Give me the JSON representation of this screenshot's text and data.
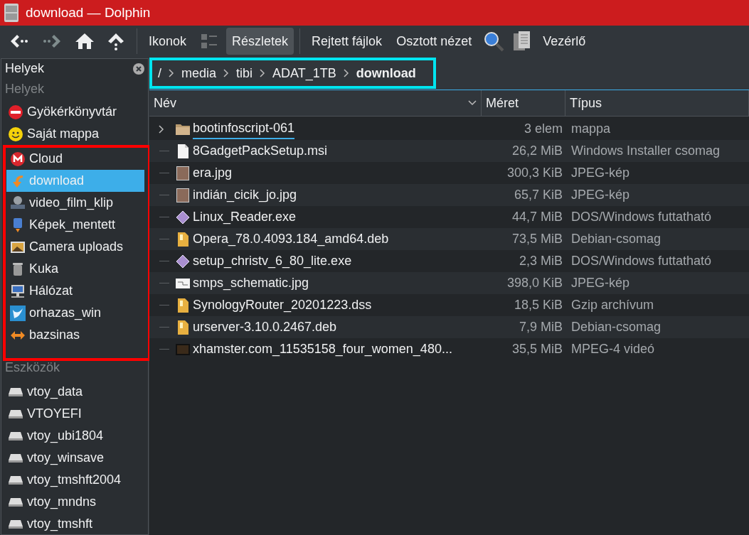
{
  "window": {
    "title": "download — Dolphin"
  },
  "toolbar": {
    "buttons": [
      {
        "kind": "back",
        "disabled": false
      },
      {
        "kind": "forward",
        "disabled": true
      },
      {
        "kind": "home",
        "disabled": false
      },
      {
        "kind": "up",
        "disabled": false
      }
    ],
    "views": [
      {
        "kind": "text",
        "label": "Ikonok",
        "selected": false
      },
      {
        "kind": "compact",
        "selected": false
      },
      {
        "kind": "text",
        "label": "Részletek",
        "selected": true
      }
    ],
    "actions": [
      {
        "kind": "text",
        "label": "Rejtett fájlok"
      },
      {
        "kind": "text",
        "label": "Osztott nézet"
      },
      {
        "kind": "search"
      },
      {
        "kind": "preview"
      },
      {
        "kind": "text",
        "label": "Vezérlő"
      }
    ]
  },
  "sidebar": {
    "title": "Helyek",
    "sections": [
      {
        "heading": "Helyek",
        "items": [
          {
            "label": "Gyökérkönyvtár",
            "kind": "root",
            "selected": false,
            "highlighted": false
          },
          {
            "label": "Saját mappa",
            "kind": "smiley",
            "selected": false,
            "highlighted": false
          },
          {
            "label": "Cloud",
            "kind": "cloud",
            "selected": false,
            "highlighted": true
          },
          {
            "label": "download",
            "kind": "download",
            "selected": true,
            "highlighted": true
          },
          {
            "label": "video_film_klip",
            "kind": "film",
            "selected": false,
            "highlighted": true
          },
          {
            "label": "Képek_mentett",
            "kind": "bookmark",
            "selected": false,
            "highlighted": true
          },
          {
            "label": "Camera uploads",
            "kind": "picture",
            "selected": false,
            "highlighted": true
          },
          {
            "label": "Kuka",
            "kind": "trash",
            "selected": false,
            "highlighted": true
          },
          {
            "label": "Hálózat",
            "kind": "network",
            "selected": false,
            "highlighted": true
          },
          {
            "label": "orhazas_win",
            "kind": "bird",
            "selected": false,
            "highlighted": true
          },
          {
            "label": "bazsinas",
            "kind": "arrows",
            "selected": false,
            "highlighted": true
          }
        ]
      },
      {
        "heading": "Eszközök",
        "items": [
          {
            "label": "vtoy_data",
            "kind": "drive",
            "selected": false,
            "highlighted": false
          },
          {
            "label": "VTOYEFI",
            "kind": "drive",
            "selected": false,
            "highlighted": false
          },
          {
            "label": "vtoy_ubi1804",
            "kind": "drive",
            "selected": false,
            "highlighted": false
          },
          {
            "label": "vtoy_winsave",
            "kind": "drive",
            "selected": false,
            "highlighted": false
          },
          {
            "label": "vtoy_tmshft2004",
            "kind": "drive",
            "selected": false,
            "highlighted": false
          },
          {
            "label": "vtoy_mndns",
            "kind": "drive",
            "selected": false,
            "highlighted": false
          },
          {
            "label": "vtoy_tmshft",
            "kind": "drive",
            "selected": false,
            "highlighted": false
          }
        ]
      }
    ]
  },
  "breadcrumb": {
    "highlighted": true,
    "segments": [
      {
        "label": "/",
        "current": false
      },
      {
        "label": "media",
        "current": false
      },
      {
        "label": "tibi",
        "current": false
      },
      {
        "label": "ADAT_1TB",
        "current": false
      },
      {
        "label": "download",
        "current": true
      }
    ]
  },
  "table": {
    "columns": [
      "Név",
      "Méret",
      "Típus"
    ],
    "rows": [
      {
        "name": "bootinfoscript-061",
        "size": "3 elem",
        "type": "mappa",
        "kind": "folder",
        "expandable": true,
        "hovered": true
      },
      {
        "name": "8GadgetPackSetup.msi",
        "size": "26,2 MiB",
        "type": "Windows Installer csomag",
        "kind": "document",
        "expandable": false,
        "hovered": false
      },
      {
        "name": "era.jpg",
        "size": "300,3 KiB",
        "type": "JPEG-kép",
        "kind": "image",
        "expandable": false,
        "hovered": false
      },
      {
        "name": "indián_cicik_jo.jpg",
        "size": "65,7 KiB",
        "type": "JPEG-kép",
        "kind": "image",
        "expandable": false,
        "hovered": false
      },
      {
        "name": "Linux_Reader.exe",
        "size": "44,7 MiB",
        "type": "DOS/Windows futtatható",
        "kind": "exe",
        "expandable": false,
        "hovered": false
      },
      {
        "name": "Opera_78.0.4093.184_amd64.deb",
        "size": "73,5 MiB",
        "type": "Debian-csomag",
        "kind": "package",
        "expandable": false,
        "hovered": false
      },
      {
        "name": "setup_christv_6_80_lite.exe",
        "size": "2,3 MiB",
        "type": "DOS/Windows futtatható",
        "kind": "exe",
        "expandable": false,
        "hovered": false
      },
      {
        "name": "smps_schematic.jpg",
        "size": "398,0 KiB",
        "type": "JPEG-kép",
        "kind": "schematic",
        "expandable": false,
        "hovered": false
      },
      {
        "name": "SynologyRouter_20201223.dss",
        "size": "18,5 KiB",
        "type": "Gzip archívum",
        "kind": "package",
        "expandable": false,
        "hovered": false
      },
      {
        "name": "urserver-3.10.0.2467.deb",
        "size": "7,9 MiB",
        "type": "Debian-csomag",
        "kind": "package",
        "expandable": false,
        "hovered": false
      },
      {
        "name": "xhamster.com_11535158_four_women_480...",
        "size": "35,5 MiB",
        "type": "MPEG-4 videó",
        "kind": "video",
        "expandable": false,
        "hovered": false
      }
    ]
  }
}
